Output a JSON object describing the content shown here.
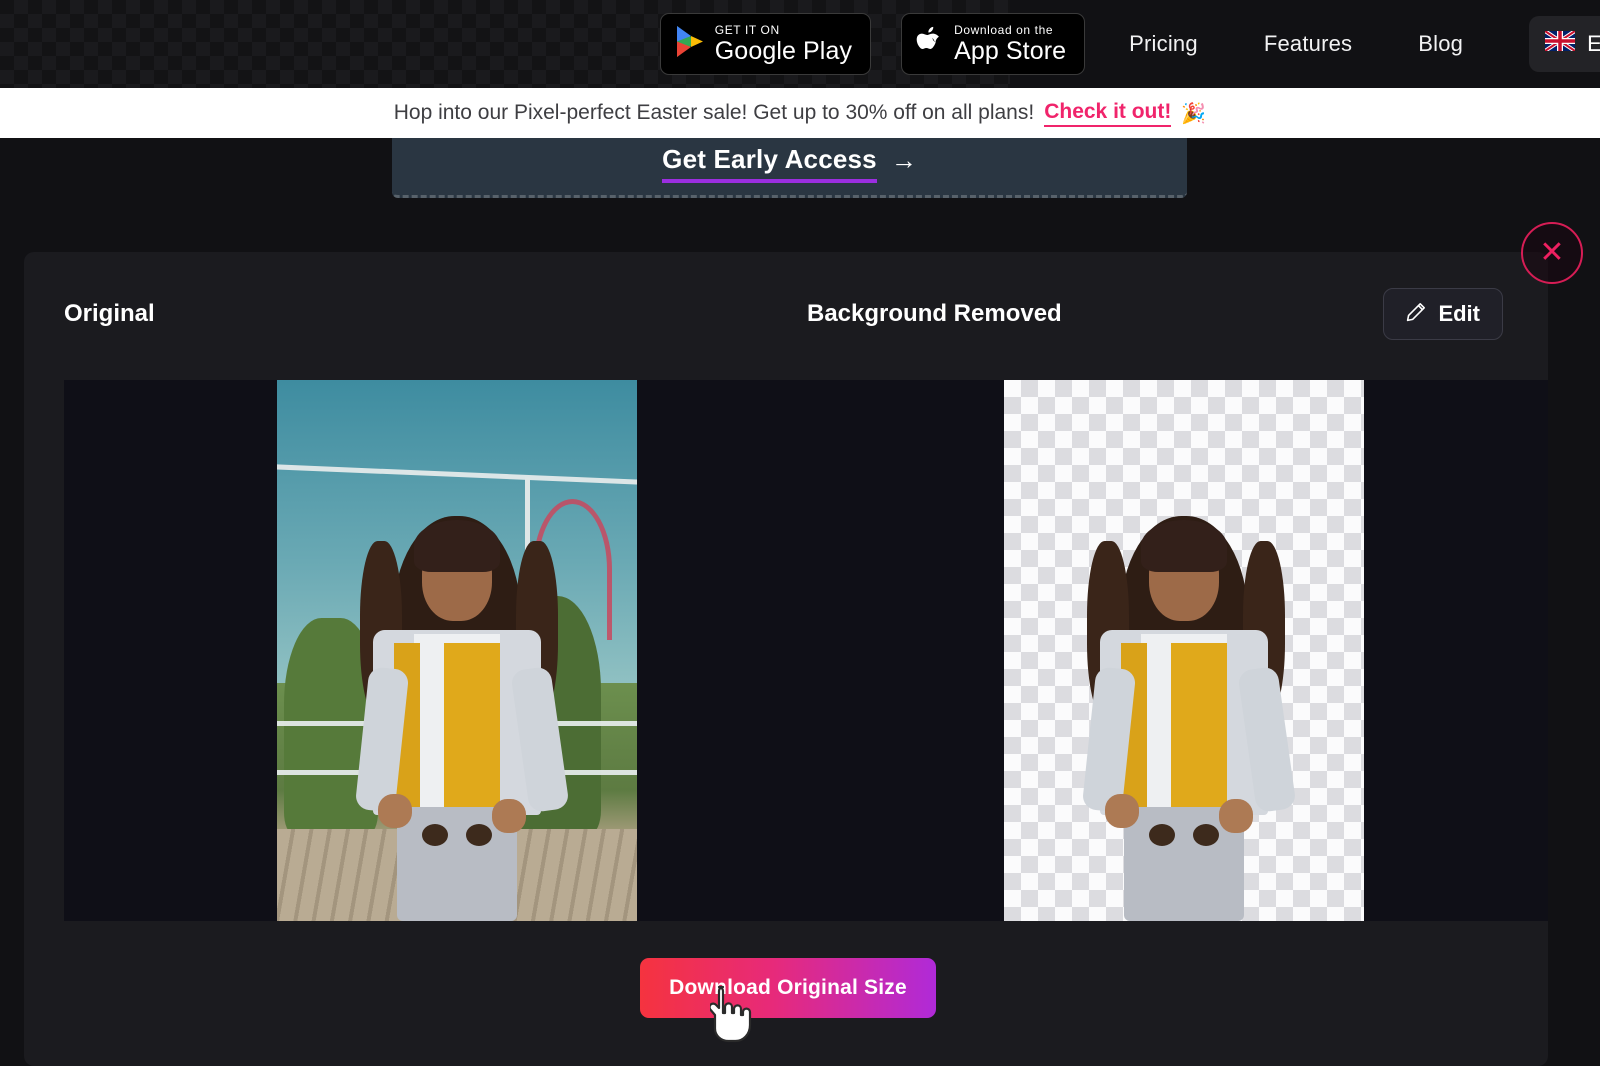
{
  "topnav": {
    "google_play": {
      "small": "GET IT ON",
      "big": "Google Play"
    },
    "app_store": {
      "small": "Download on the",
      "big": "App Store"
    },
    "links": [
      {
        "label": "Pricing"
      },
      {
        "label": "Features"
      },
      {
        "label": "Blog"
      }
    ],
    "language": {
      "flag": "🇬🇧",
      "label": "En"
    }
  },
  "promo": {
    "text": "Hop into our Pixel-perfect Easter sale! Get up to 30% off on all plans!",
    "cta": "Check it out!",
    "emoji": "🎉"
  },
  "early_access": {
    "label": "Get Early Access",
    "arrow": "→"
  },
  "modal": {
    "original_label": "Original",
    "removed_label": "Background Removed",
    "edit_label": "Edit",
    "edit_icon": "pencil-icon",
    "download_label": "Download Original Size",
    "close_icon": "✕"
  },
  "colors": {
    "promo_accent": "#f0246b",
    "early_access_underline": "#9b2ee0",
    "download_gradient_start": "#f5333f",
    "download_gradient_end": "#b02ad8",
    "close_accent": "#ee2061",
    "modal_bg": "#1b1b1f",
    "panel_bg": "#0f0f17",
    "card_bg": "#2a3642"
  }
}
